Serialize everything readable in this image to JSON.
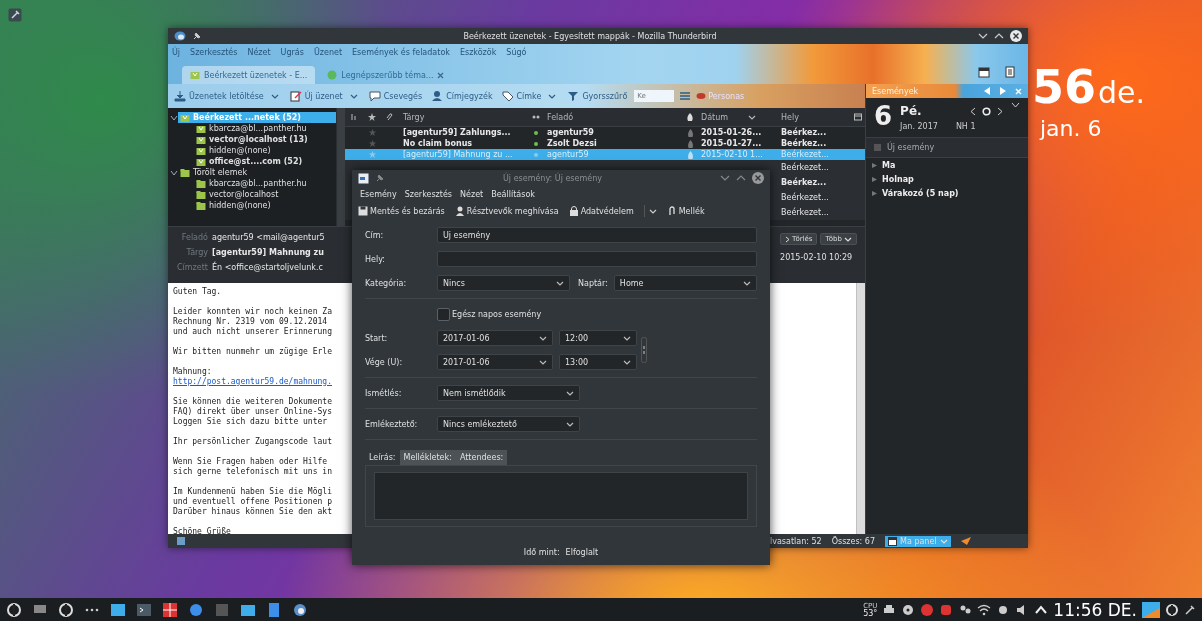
{
  "desktop": {
    "clock": {
      "time": "56",
      "meridiem": "de.",
      "date": "jan. 6"
    }
  },
  "mail_window": {
    "title": "Beérkezett üzenetek - Egyesített mappák - Mozilla Thunderbird",
    "menu": [
      "Új",
      "Szerkesztés",
      "Nézet",
      "Ugrás",
      "Üzenet",
      "Események és feladatok",
      "Eszközök",
      "Súgó"
    ],
    "tabs": [
      {
        "label": "Beérkezett üzenetek - E...",
        "selected": true
      },
      {
        "label": "Legnépszerűbb téma...",
        "selected": false
      }
    ],
    "toolbar": [
      {
        "label": "Üzenetek letöltése",
        "dropdown": true
      },
      {
        "label": "Új üzenet",
        "dropdown": true
      },
      {
        "label": "Csevegés",
        "dropdown": false
      },
      {
        "label": "Címjegyzék",
        "dropdown": false
      },
      {
        "label": "Címke",
        "dropdown": true
      },
      {
        "label": "Gyorsszűrő",
        "dropdown": false
      }
    ],
    "search": {
      "placeholder": "Ke"
    },
    "personas": "Personas",
    "folders": [
      {
        "label": "Beérkezett ...netek (52)",
        "unread": true,
        "selected": true,
        "expanded": true,
        "children": [
          {
            "label": "kbarcza@bl...panther.hu",
            "unread": false,
            "selected": false
          },
          {
            "label": "vector@localhost (13)",
            "unread": true,
            "selected": false
          },
          {
            "label": "hidden@(none)",
            "unread": false,
            "selected": false
          },
          {
            "label": "office@st....com (52)",
            "unread": true,
            "selected": false
          }
        ]
      },
      {
        "label": "Törölt elemek",
        "unread": false,
        "selected": false,
        "expanded": true,
        "children": [
          {
            "label": "kbarcza@bl...panther.hu",
            "unread": false,
            "selected": false
          },
          {
            "label": "vector@localhost",
            "unread": false,
            "selected": false
          },
          {
            "label": "hidden@(none)",
            "unread": false,
            "selected": false
          }
        ]
      }
    ],
    "message_list": {
      "columns": [
        "Tárgy",
        "Feladó",
        "Dátum",
        "Hely"
      ],
      "rows": [
        {
          "subject": "[agentur59] Zahlungs...",
          "sender": "agentur59",
          "date": "2015-01-26...",
          "folder": "Beérkez...",
          "unread": true,
          "selected": false
        },
        {
          "subject": "No claim bonus",
          "sender": "Zsolt Dezsi",
          "date": "2015-01-27...",
          "folder": "Beérkez...",
          "unread": true,
          "selected": false
        },
        {
          "subject": "[agentur59] Mahnung zu ...",
          "sender": "agentur59",
          "date": "2015-02-10 1...",
          "folder": "Beérkezet...",
          "unread": false,
          "selected": true
        },
        {
          "folder": "Beérkezet...",
          "unread": false,
          "selected": false
        },
        {
          "folder": "Beérkez...",
          "unread": true,
          "selected": false
        },
        {
          "folder": "Beérkezet...",
          "unread": false,
          "selected": false
        },
        {
          "folder": "Beérkezet...",
          "unread": false,
          "selected": false
        }
      ]
    },
    "message_header": {
      "from_label": "Feladó",
      "from": "agentur59 <mail@agentur5",
      "subject_label": "Tárgy",
      "subject": "[agentur59] Mahnung zu",
      "to_label": "Címzett",
      "to": "Én <office@startoljvelunk.c",
      "buttons": [
        "Törlés",
        "Több"
      ],
      "date": "2015-02-10 10:29"
    },
    "body": [
      {
        "kind": "text",
        "text": "Guten Tag."
      },
      {
        "kind": "text",
        "text": "Leider konnten wir noch keinen Za\nRechnung Nr. 2319 vom 09.12.2014\nund auch nicht unserer Erinnerung"
      },
      {
        "kind": "text",
        "text": "Wir bitten nunmehr um zügige Erle"
      },
      {
        "kind": "label",
        "text": "Mahnung:"
      },
      {
        "kind": "link",
        "text": "http://post.agentur59.de/mahnung."
      },
      {
        "kind": "text",
        "text": "Sie können die weiteren Dokumente\nFAQ) direkt über unser Online-Sys\nLoggen Sie sich dazu bitte unter"
      },
      {
        "kind": "text",
        "text": "Ihr persönlicher Zugangscode laut"
      },
      {
        "kind": "text",
        "text": "Wenn Sie Fragen haben oder Hilfe\nsich gerne telefonisch mit uns in"
      },
      {
        "kind": "text",
        "text": "Im Kundenmenü haben Sie die Mögli\nund eventuell offene Positionen p\nDarüber hinaus können Sie den akt"
      },
      {
        "kind": "text",
        "text": "Schöne Grüße"
      }
    ],
    "status_bar": {
      "unread": "lvasatlan: 52",
      "total": "Összes: 67",
      "today_pane": "Ma panel"
    },
    "events_pane": {
      "title": "Események",
      "day": "6",
      "weekday": "Pé.",
      "month": "Jan. 2017",
      "week": "NH 1",
      "new_event": "Új esemény",
      "groups": [
        "Ma",
        "Holnap",
        "Várakozó (5 nap)"
      ]
    }
  },
  "dialog": {
    "title": "Új esemény: Új esemény",
    "menu": [
      "Esemény",
      "Szerkesztés",
      "Nézet",
      "Beállítások"
    ],
    "toolbar": [
      "Mentés és bezárás",
      "Résztvevők meghívása",
      "Adatvédelem",
      "Mellék"
    ],
    "title_field": {
      "label": "Cím:",
      "value": "Új esemény"
    },
    "location_field": {
      "label": "Hely:"
    },
    "category": {
      "label": "Kategória:",
      "value": "Nincs"
    },
    "calendar": {
      "label": "Naptár:",
      "value": "Home"
    },
    "all_day": {
      "label": "Egész napos esemény",
      "checked": false
    },
    "start": {
      "label": "Start:",
      "date": "2017-01-06",
      "time": "12:00"
    },
    "end": {
      "label": "Vége (U):",
      "date": "2017-01-06",
      "time": "13:00"
    },
    "repeat": {
      "label": "Ismétlés:",
      "value": "Nem ismétlődik"
    },
    "reminder": {
      "label": "Emlékeztető:",
      "value": "Nincs emlékeztető"
    },
    "tabs": [
      {
        "label": "Leírás:",
        "selected": true
      },
      {
        "label": "Mellékletek:",
        "selected": false
      },
      {
        "label": "Attendees:",
        "selected": false
      }
    ],
    "footer": {
      "label": "Idő mint:",
      "value": "Elfoglalt"
    }
  },
  "taskbar": {
    "cpu_label": "CPU",
    "temperature": "53°",
    "clock": "11:56 DE."
  }
}
